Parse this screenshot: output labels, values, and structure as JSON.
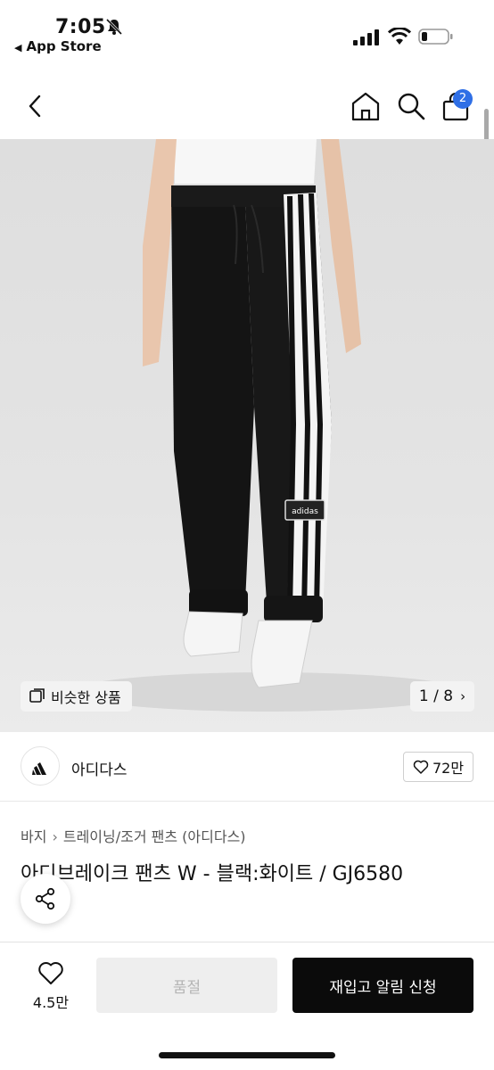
{
  "status_bar": {
    "time": "7:05",
    "back_app": "App Store",
    "icons": [
      "bell-slash-icon",
      "signal-icon",
      "wifi-icon",
      "battery-icon"
    ]
  },
  "nav": {
    "cart_badge": "2",
    "icons": [
      "back-chevron-icon",
      "home-icon",
      "search-icon",
      "cart-icon"
    ]
  },
  "hero": {
    "similar_label": "비슷한 상품",
    "pager": "1 / 8",
    "logo_text": "adidas"
  },
  "brand": {
    "name": "아디다스",
    "likes": "72만"
  },
  "breadcrumb": {
    "items": [
      "바지",
      "트레이닝/조거 팬츠 (아디다스)"
    ]
  },
  "product": {
    "title": "아디브레이크 팬츠 W - 블랙:화이트 / GJ6580"
  },
  "bottom": {
    "heart_count": "4.5만",
    "soldout_label": "품절",
    "restock_label": "재입고 알림 신청"
  },
  "colors": {
    "accent_badge": "#2f6fe6",
    "primary_button": "#0b0b0b",
    "disabled_button": "#eeeeee"
  }
}
